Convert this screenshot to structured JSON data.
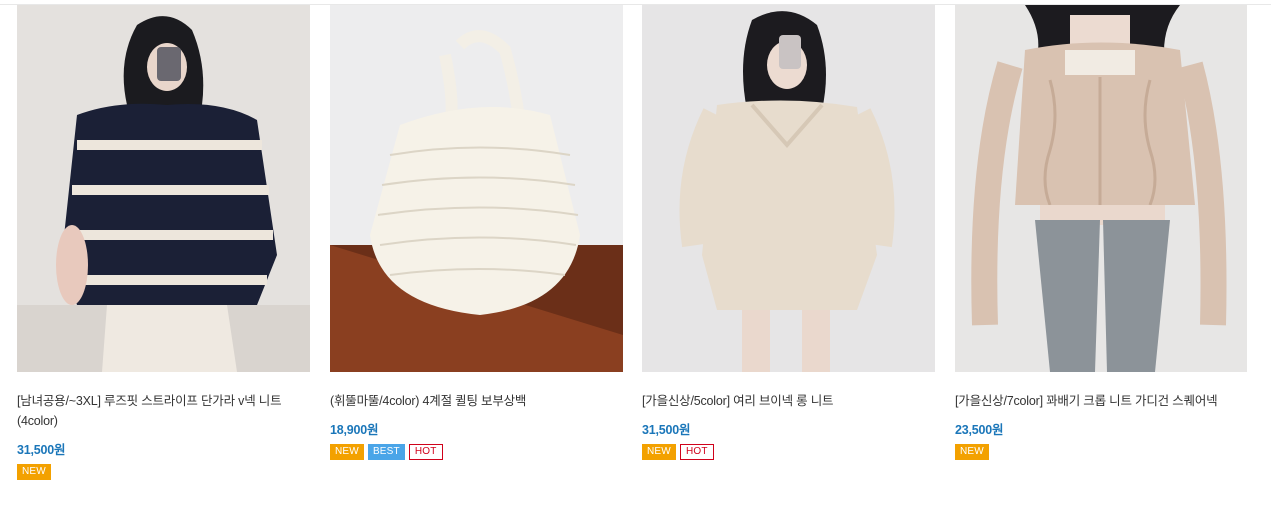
{
  "products": [
    {
      "name": "[남녀공용/~3XL] 루즈핏 스트라이프 단가라 v넥 니트 (4color)",
      "price": "31,500원",
      "image_desc": "striped-navy-knit-photo",
      "badges": [
        "NEW"
      ]
    },
    {
      "name": "(휘뚤마뚤/4color) 4계절 퀼팅 보부상백",
      "price": "18,900원",
      "image_desc": "quilted-tote-bag-photo",
      "badges": [
        "NEW",
        "BEST",
        "HOT"
      ]
    },
    {
      "name": "[가을신상/5color] 여리 브이넥 롱 니트",
      "price": "31,500원",
      "image_desc": "beige-vneck-long-knit-photo",
      "badges": [
        "NEW",
        "HOT"
      ]
    },
    {
      "name": "[가을신상/7color] 꽈배기 크롭 니트 가디건 스퀘어넥",
      "price": "23,500원",
      "image_desc": "cable-crop-cardigan-photo",
      "badges": [
        "NEW"
      ]
    }
  ],
  "badge_colors": {
    "NEW": "#f3a100",
    "BEST": "#4aa5e8",
    "HOT": "#d0021b"
  },
  "price_color": "#1a76b9"
}
